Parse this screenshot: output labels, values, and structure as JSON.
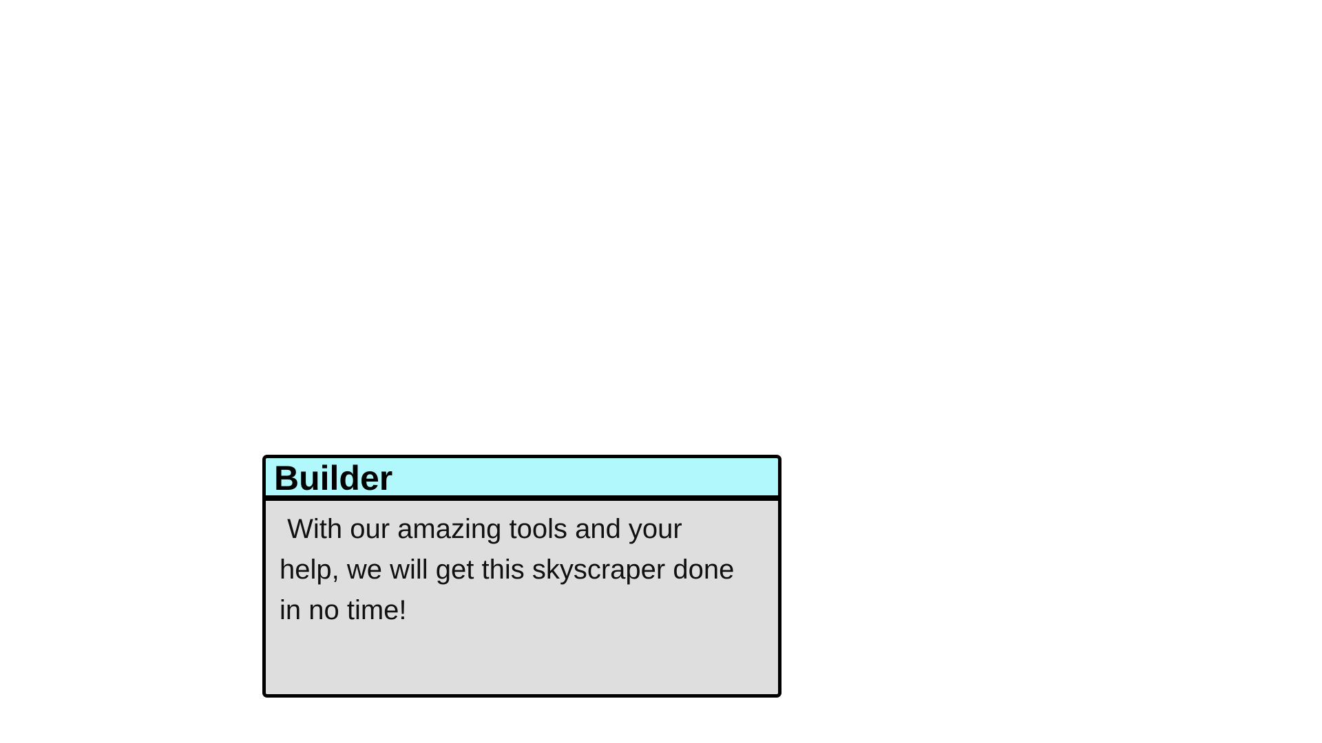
{
  "dialog": {
    "speaker": "Builder",
    "text": " With our amazing tools and your\nhelp, we will get this skyscraper done\nin no time!"
  },
  "colors": {
    "name_plate": "#b0f8fc",
    "text_box": "#dedede",
    "border": "#000000",
    "background": "#ffffff"
  }
}
